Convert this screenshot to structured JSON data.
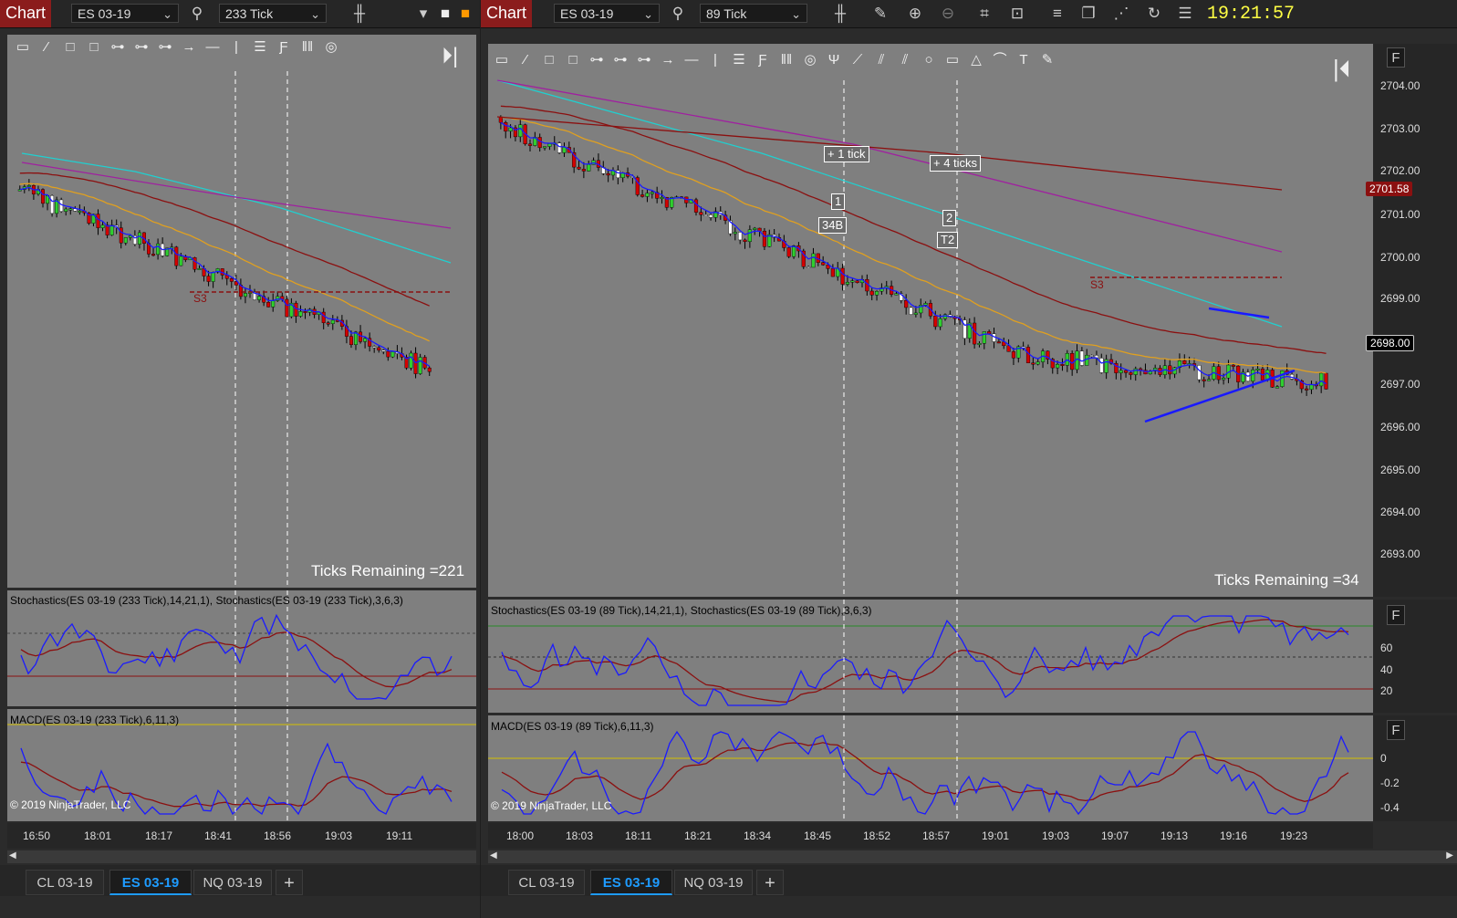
{
  "left_window": {
    "chart_button": "Chart",
    "instrument": "ES 03-19",
    "interval": "233 Tick",
    "ticks_remaining": "Ticks Remaining =221",
    "s3_label": "S3",
    "stoch_title": "Stochastics(ES 03-19 (233 Tick),14,21,1), Stochastics(ES 03-19 (233 Tick),3,6,3)",
    "macd_title": "MACD(ES 03-19 (233 Tick),6,11,3)",
    "copyright": "© 2019 NinjaTrader, LLC",
    "time_labels": [
      "16:50",
      "18:01",
      "18:17",
      "18:41",
      "18:56",
      "19:03",
      "19:11"
    ],
    "tabs": [
      "CL 03-19",
      "ES 03-19",
      "NQ 03-19",
      "+"
    ]
  },
  "right_window": {
    "chart_button": "Chart",
    "instrument": "ES 03-19",
    "interval": "89 Tick",
    "clock": "19:21:57",
    "ticks_remaining": "Ticks Remaining =34",
    "s3_label": "S3",
    "annotations": [
      "+ 1 tick",
      "+ 4 ticks",
      "1",
      "34B",
      "2",
      "T2"
    ],
    "price_labels": [
      "2704.00",
      "2703.00",
      "2702.00",
      "2701.00",
      "2700.00",
      "2699.00",
      "2697.00",
      "2696.00",
      "2695.00",
      "2694.00",
      "2693.00"
    ],
    "price_tag_red": "2701.58",
    "price_tag_current": "2698.00",
    "stoch_title": "Stochastics(ES 03-19 (89 Tick),14,21,1), Stochastics(ES 03-19 (89 Tick),3,6,3)",
    "stoch_scale": [
      "60",
      "40",
      "20"
    ],
    "macd_title": "MACD(ES 03-19 (89 Tick),6,11,3)",
    "macd_scale": [
      "0",
      "-0.2",
      "-0.4"
    ],
    "copyright": "© 2019 NinjaTrader, LLC",
    "time_labels": [
      "18:00",
      "18:03",
      "18:11",
      "18:21",
      "18:34",
      "18:45",
      "18:52",
      "18:57",
      "19:01",
      "19:03",
      "19:07",
      "19:13",
      "19:16",
      "19:23"
    ],
    "tabs": [
      "CL 03-19",
      "ES 03-19",
      "NQ 03-19",
      "+"
    ],
    "f_label": "F"
  },
  "colors": {
    "chart_bg": "#7f7f7f",
    "up_bar": "#2fcf2f",
    "down_bar": "#d40000",
    "stoch_fast": "#1a1aff",
    "stoch_slow": "#8b1010",
    "macd_zero": "#d4c000"
  }
}
